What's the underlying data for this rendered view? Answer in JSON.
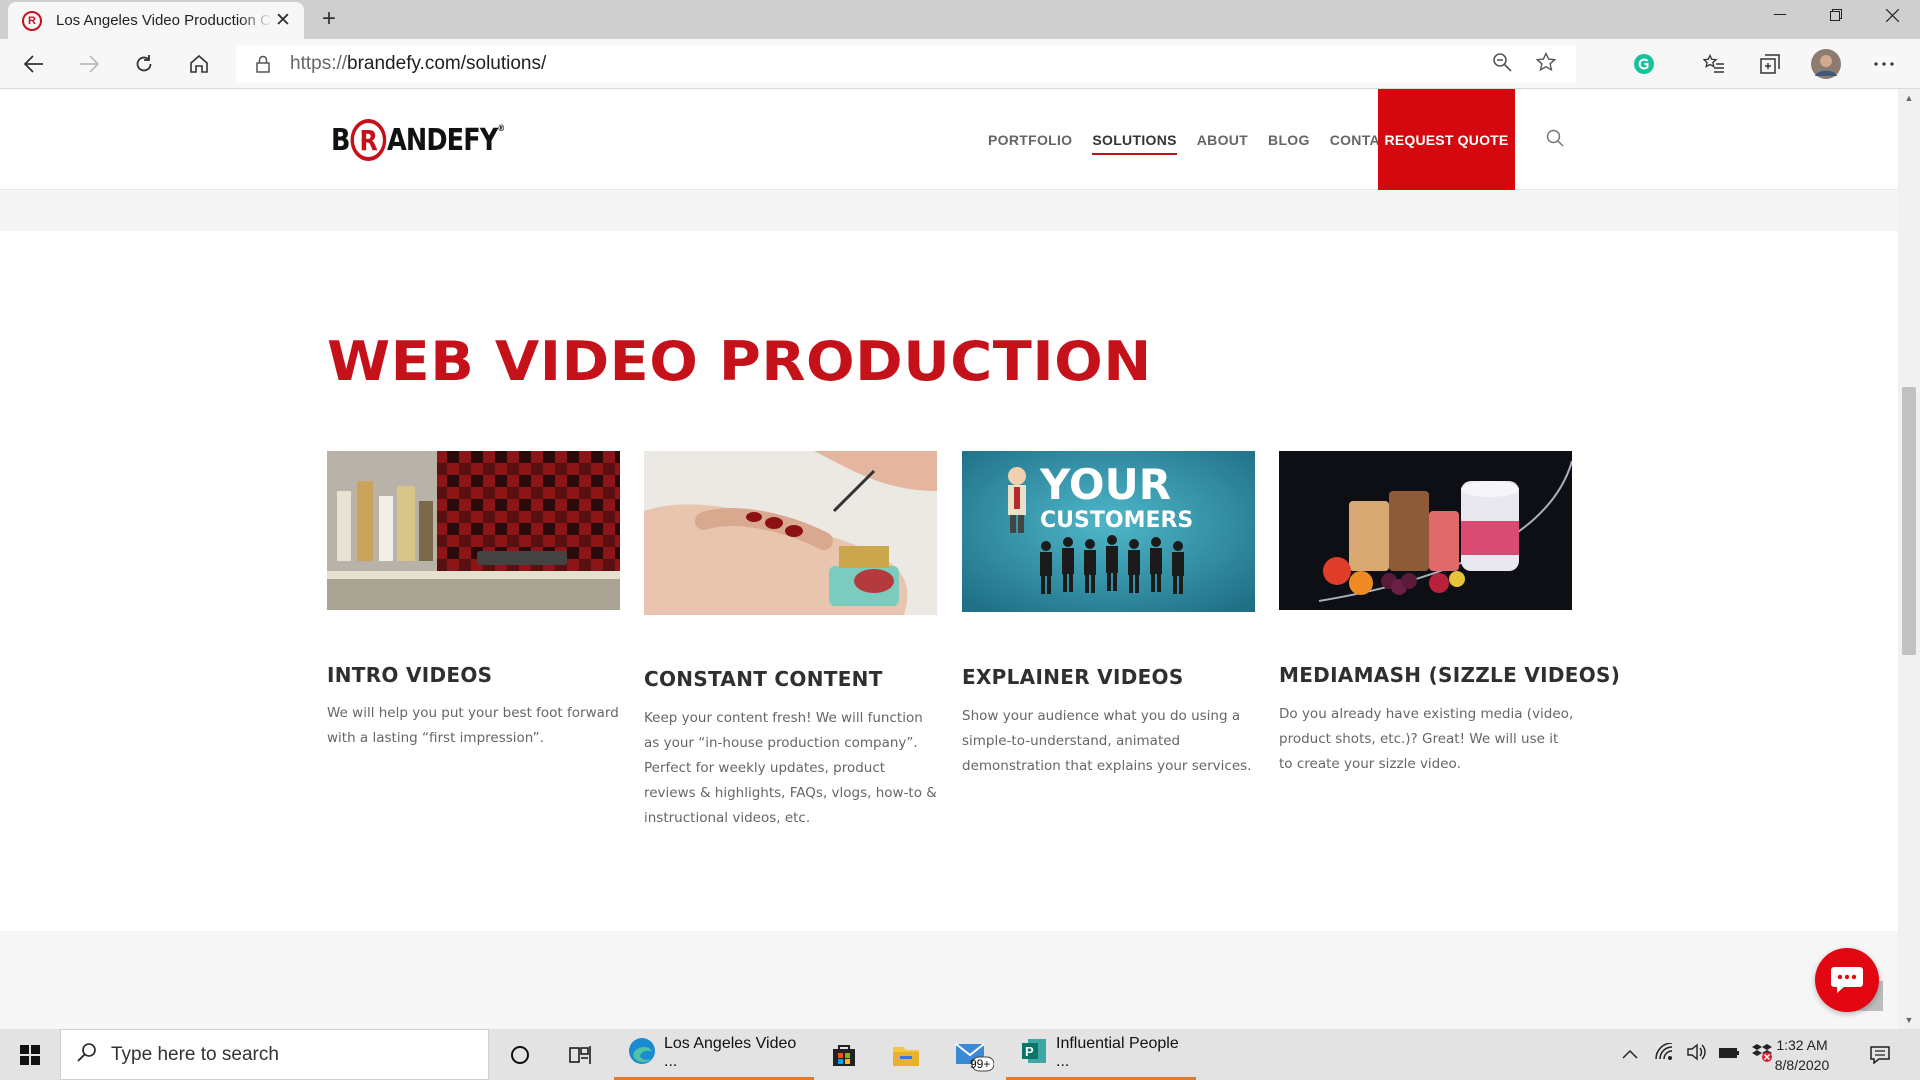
{
  "browser": {
    "tab_title": "Los Angeles Video Production Co",
    "url_scheme": "https://",
    "url_rest": "brandefy.com/solutions/"
  },
  "site": {
    "logo_left": "B",
    "logo_circle": "R",
    "logo_right": "ANDEFY",
    "logo_mark": "®",
    "nav": [
      "PORTFOLIO",
      "SOLUTIONS",
      "ABOUT",
      "BLOG",
      "CONTACT"
    ],
    "active_nav": "SOLUTIONS",
    "cta": "REQUEST QUOTE"
  },
  "section": {
    "title": "WEB VIDEO PRODUCTION",
    "cards": [
      {
        "title": "INTRO VIDEOS",
        "text": "We will help you put your best foot forward with a lasting “first impression”."
      },
      {
        "title": "CONSTANT CONTENT",
        "text": "Keep your content fresh! We will function as your “in-house production company”. Perfect for weekly updates, product reviews & highlights, FAQs, vlogs, how-to & instructional videos, etc."
      },
      {
        "title": "EXPLAINER VIDEOS",
        "text": "Show your audience what you do using a simple-to-understand, animated demonstration that explains your services."
      },
      {
        "title": "MEDIAMASH (SIZZLE VIDEOS)",
        "text": "Do you already have existing media (video, product shots, etc.)? Great! We will use it to create your sizzle video."
      }
    ],
    "explainer_image_text": [
      "YOUR",
      "CUSTOMERS"
    ]
  },
  "taskbar": {
    "search_placeholder": "Type here to search",
    "apps": [
      {
        "label": "Los Angeles Video ..."
      },
      {
        "label": "Influential People ..."
      }
    ],
    "mail_badge": "99+",
    "time": "1:32 AM",
    "date": "8/8/2020"
  },
  "colors": {
    "brand_red": "#c5111a",
    "cta_red": "#d6080f",
    "taskbar_accent": "#e07a2f"
  },
  "icons": [
    "back-icon",
    "forward-icon",
    "refresh-icon",
    "home-icon",
    "lock-icon",
    "zoom-icon",
    "favorite-star-icon",
    "grammarly-icon",
    "favorites-list-icon",
    "collections-icon",
    "profile-avatar",
    "more-icon",
    "search-icon",
    "chat-icon",
    "windows-icon",
    "cortana-icon",
    "task-view-icon",
    "edge-icon",
    "store-icon",
    "file-explorer-icon",
    "mail-icon",
    "publisher-icon",
    "wifi-icon",
    "volume-icon",
    "battery-icon",
    "dropbox-icon",
    "notification-icon"
  ]
}
